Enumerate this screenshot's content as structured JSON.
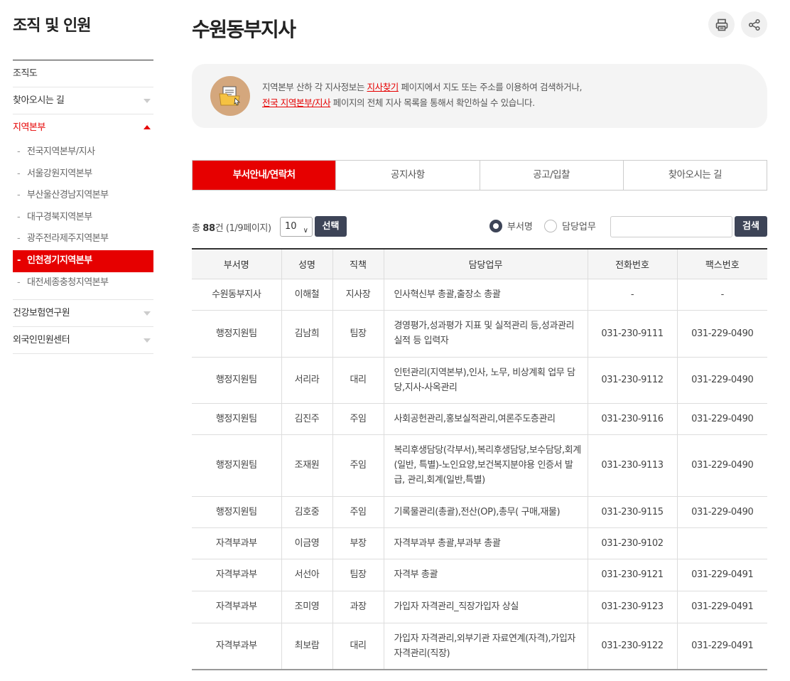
{
  "sidebar": {
    "title": "조직 및 인원",
    "menu": [
      {
        "label": "조직도"
      },
      {
        "label": "찾아오시는 길"
      },
      {
        "label": "지역본부"
      }
    ],
    "submenu": [
      {
        "label": "전국지역본부/지사"
      },
      {
        "label": "서울강원지역본부"
      },
      {
        "label": "부산울산경남지역본부"
      },
      {
        "label": "대구경북지역본부"
      },
      {
        "label": "광주전라제주지역본부"
      },
      {
        "label": "인천경기지역본부"
      },
      {
        "label": "대전세종충청지역본부"
      }
    ],
    "menu_after": [
      {
        "label": "건강보험연구원"
      },
      {
        "label": "외국인민원센터"
      }
    ],
    "dash": "-"
  },
  "page": {
    "title": "수원동부지사",
    "print_icon": "printer-icon",
    "share_icon": "share-icon"
  },
  "info": {
    "icon": "folder-document-icon",
    "line1_prefix": "지역본부 산하 각 지사정보는 ",
    "line1_link": "지사찾기",
    "line1_suffix": " 페이지에서 지도 또는 주소를 이용하여 검색하거나,",
    "line2_link": "전국 지역본부/지사",
    "line2_suffix": " 페이지의 전체 지사 목록을 통해서 확인하실 수 있습니다."
  },
  "tabs": [
    {
      "label": "부서안내/연락처"
    },
    {
      "label": "공지사항"
    },
    {
      "label": "공고/입찰"
    },
    {
      "label": "찾아오시는 길"
    }
  ],
  "controls": {
    "total_prefix": "총 ",
    "total_count": "88",
    "total_suffix": "건 (1/9페이지)",
    "per_page": "10",
    "select_button": "선택",
    "radio_dept": "부서명",
    "radio_duty": "담당업무",
    "search_value": "",
    "search_button": "검색"
  },
  "table": {
    "headers": [
      "부서명",
      "성명",
      "직책",
      "담당업무",
      "전화번호",
      "팩스번호"
    ],
    "rows": [
      {
        "dept": "수원동부지사",
        "name": "이해철",
        "title": "지사장",
        "duty": "인사혁신부 총괄,출장소 총괄",
        "phone": "-",
        "fax": "-"
      },
      {
        "dept": "행정지원팀",
        "name": "김남희",
        "title": "팀장",
        "duty": "경영평가,성과평가 지표 및 실적관리 등,성과관리 실적 등 입력자",
        "phone": "031-230-9111",
        "fax": "031-229-0490"
      },
      {
        "dept": "행정지원팀",
        "name": "서리라",
        "title": "대리",
        "duty": "인턴관리(지역본부),인사, 노무, 비상계획 업무 담당,지사-사옥관리",
        "phone": "031-230-9112",
        "fax": "031-229-0490"
      },
      {
        "dept": "행정지원팀",
        "name": "김진주",
        "title": "주임",
        "duty": "사회공헌관리,홍보실적관리,여론주도층관리",
        "phone": "031-230-9116",
        "fax": "031-229-0490"
      },
      {
        "dept": "행정지원팀",
        "name": "조재원",
        "title": "주임",
        "duty": "복리후생담당(각부서),복리후생담당,보수담당,회계(일반, 특별)-노인요양,보건복지분야용 인증서 발급, 관리,회계(일반,특별)",
        "phone": "031-230-9113",
        "fax": "031-229-0490"
      },
      {
        "dept": "행정지원팀",
        "name": "김호중",
        "title": "주임",
        "duty": "기록물관리(총괄),전산(OP),총무( 구매,재물)",
        "phone": "031-230-9115",
        "fax": "031-229-0490"
      },
      {
        "dept": "자격부과부",
        "name": "이금영",
        "title": "부장",
        "duty": "자격부과부 총괄,부과부 총괄",
        "phone": "031-230-9102",
        "fax": ""
      },
      {
        "dept": "자격부과부",
        "name": "서선아",
        "title": "팀장",
        "duty": "자격부 총괄",
        "phone": "031-230-9121",
        "fax": "031-229-0491"
      },
      {
        "dept": "자격부과부",
        "name": "조미영",
        "title": "과장",
        "duty": "가입자 자격관리_직장가입자 상실",
        "phone": "031-230-9123",
        "fax": "031-229-0491"
      },
      {
        "dept": "자격부과부",
        "name": "최보람",
        "title": "대리",
        "duty": "가입자 자격관리,외부기관 자료연계(자격),가입자 자격관리(직장)",
        "phone": "031-230-9122",
        "fax": "031-229-0491"
      }
    ]
  },
  "colors": {
    "accent": "#e60000",
    "dark_button": "#3d4457"
  }
}
